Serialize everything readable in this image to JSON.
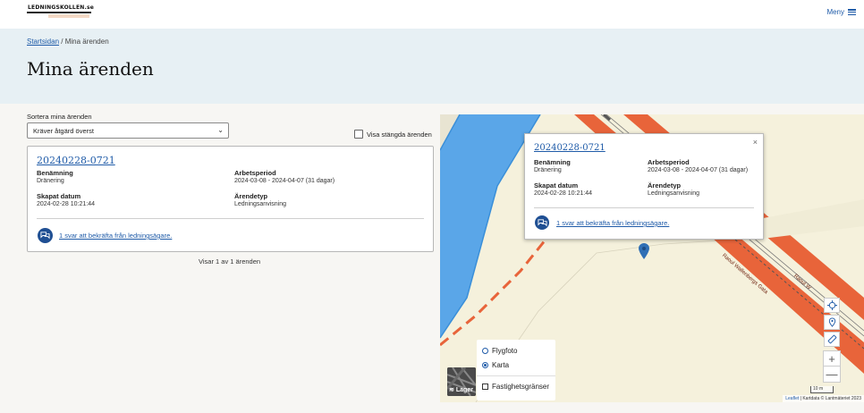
{
  "header": {
    "logo_text": "LEDNINGSKOLLEN.se",
    "menu_label": "Meny"
  },
  "breadcrumb": {
    "home": "Startsidan",
    "separator": "/",
    "current": "Mina ärenden"
  },
  "page_title": "Mina ärenden",
  "sort": {
    "label": "Sortera mina ärenden",
    "selected": "Kräver åtgärd överst"
  },
  "show_closed_label": "Visa stängda ärenden",
  "case": {
    "id": "20240228-0721",
    "name_label": "Benämning",
    "name_value": "Dränering",
    "period_label": "Arbetsperiod",
    "period_value": "2024-03-08 - 2024-04-07 (31 dagar)",
    "created_label": "Skapat datum",
    "created_value": "2024-02-28 10:21:44",
    "type_label": "Ärendetyp",
    "type_value": "Ledningsanvisning",
    "reply_link": "1 svar att bekräfta från ledningsägare."
  },
  "result_count": "Visar 1 av 1 ärenden",
  "map": {
    "popup_close": "×",
    "layers": {
      "aerial": "Flygfoto",
      "map": "Karta",
      "selected": "Karta",
      "property_borders": "Fastighetsgränser",
      "button_label": "Lager"
    },
    "road_labels": [
      "Raoul Wallenbergs Gata",
      "Raoul W"
    ],
    "scale": "10 m",
    "attribution_leaflet": "Leaflet",
    "attribution_rest": "| Kartdata © Lantmäteriet 2023",
    "zoom_in": "+",
    "zoom_out": "—"
  },
  "colors": {
    "link": "#1f5ba8",
    "hero_bg": "#e7f0f4",
    "water": "#5aa6e8",
    "road": "#e8643a",
    "icon_bg": "#1f4f93"
  },
  "icons": {
    "menu": "hamburger-icon",
    "select": "chevron-down-icon",
    "chat": "chat-bubbles-icon",
    "locate": "crosshair-icon",
    "pin": "map-pin-icon",
    "measure": "ruler-icon",
    "close": "close-icon"
  }
}
